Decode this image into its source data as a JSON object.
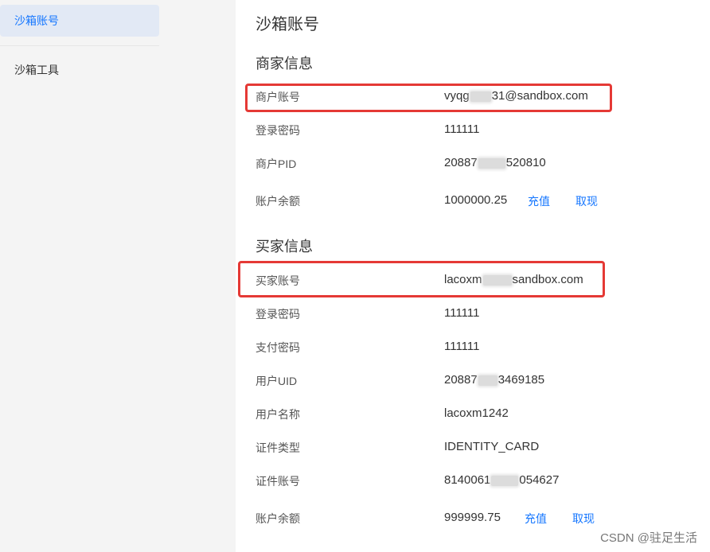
{
  "sidebar": {
    "items": [
      {
        "label": "沙箱账号"
      },
      {
        "label": "沙箱工具"
      }
    ]
  },
  "main": {
    "title": "沙箱账号",
    "merchant": {
      "section_title": "商家信息",
      "account": {
        "label": "商户账号",
        "value_prefix": "vyqg",
        "value_suffix": "31@sandbox.com"
      },
      "password": {
        "label": "登录密码",
        "value": "111111"
      },
      "pid": {
        "label": "商户PID",
        "value_prefix": "20887",
        "value_suffix": "520810"
      },
      "balance": {
        "label": "账户余额",
        "value": "1000000.25",
        "recharge": "充值",
        "withdraw": "取现"
      }
    },
    "buyer": {
      "section_title": "买家信息",
      "account": {
        "label": "买家账号",
        "value_prefix": "lacoxm",
        "value_suffix": "sandbox.com"
      },
      "password": {
        "label": "登录密码",
        "value": "111111"
      },
      "pay_password": {
        "label": "支付密码",
        "value": "111111"
      },
      "uid": {
        "label": "用户UID",
        "value_prefix": "20887",
        "value_suffix": "3469185"
      },
      "name": {
        "label": "用户名称",
        "value": "lacoxm1242"
      },
      "id_type": {
        "label": "证件类型",
        "value": "IDENTITY_CARD"
      },
      "id_number": {
        "label": "证件账号",
        "value_prefix": "8140061",
        "value_suffix": "054627"
      },
      "balance": {
        "label": "账户余额",
        "value": "999999.75",
        "recharge": "充值",
        "withdraw": "取现"
      }
    }
  },
  "watermark": "CSDN @驻足生活",
  "colors": {
    "accent": "#1677ff",
    "highlight": "#e53935",
    "sidebar_bg": "#f4f4f4",
    "active_bg": "#e2e9f5"
  }
}
